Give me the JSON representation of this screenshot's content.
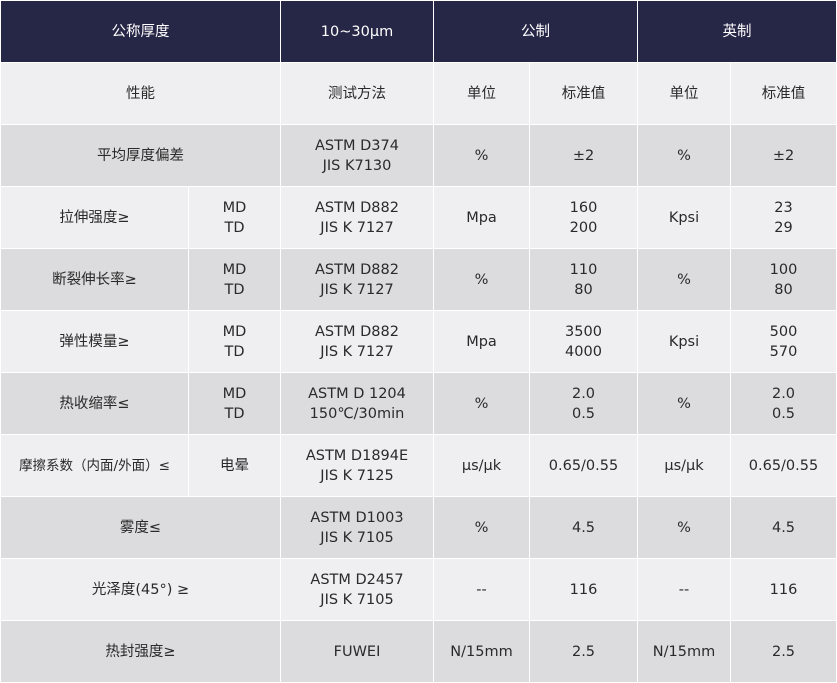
{
  "header": {
    "thickness_label": "公称厚度",
    "thickness_value": "10~30μm",
    "metric": "公制",
    "imperial": "英制"
  },
  "subheader": {
    "property": "性能",
    "method": "测试方法",
    "unit_metric": "单位",
    "std_metric": "标准值",
    "unit_imperial": "单位",
    "std_imperial": "标准值"
  },
  "rows": [
    {
      "property": "平均厚度偏差",
      "direction": "",
      "method": "ASTM D374\nJIS K7130",
      "unit_m": "%",
      "val_m": "±2",
      "unit_i": "%",
      "val_i": "±2"
    },
    {
      "property": "拉伸强度≥",
      "direction": "MD\nTD",
      "method": "ASTM D882\nJIS K 7127",
      "unit_m": "Mpa",
      "val_m": "160\n200",
      "unit_i": "Kpsi",
      "val_i": "23\n29"
    },
    {
      "property": "断裂伸长率≥",
      "direction": "MD\nTD",
      "method": "ASTM D882\nJIS K 7127",
      "unit_m": "%",
      "val_m": "110\n80",
      "unit_i": "%",
      "val_i": "100\n80"
    },
    {
      "property": "弹性模量≥",
      "direction": "MD\nTD",
      "method": "ASTM D882\nJIS K 7127",
      "unit_m": "Mpa",
      "val_m": "3500\n4000",
      "unit_i": "Kpsi",
      "val_i": "500\n570"
    },
    {
      "property": "热收缩率≤",
      "direction": "MD\nTD",
      "method": "ASTM D 1204\n150℃/30min",
      "unit_m": "%",
      "val_m": "2.0\n0.5",
      "unit_i": "%",
      "val_i": "2.0\n0.5"
    },
    {
      "property": "摩擦系数（内面/外面）≤",
      "direction": "电晕",
      "method": "ASTM D1894E\nJIS K 7125",
      "unit_m": "μs/μk",
      "val_m": "0.65/0.55",
      "unit_i": "μs/μk",
      "val_i": "0.65/0.55"
    },
    {
      "property": "雾度≤",
      "direction": "",
      "method": "ASTM D1003\nJIS K 7105",
      "unit_m": "%",
      "val_m": "4.5",
      "unit_i": "%",
      "val_i": "4.5"
    },
    {
      "property": "光泽度(45°) ≥",
      "direction": "",
      "method": "ASTM D2457\nJIS K 7105",
      "unit_m": "--",
      "val_m": "116",
      "unit_i": "--",
      "val_i": "116"
    },
    {
      "property": "热封强度≥",
      "direction": "",
      "method": "FUWEI",
      "unit_m": "N/15mm",
      "val_m": "2.5",
      "unit_i": "N/15mm",
      "val_i": "2.5"
    }
  ]
}
